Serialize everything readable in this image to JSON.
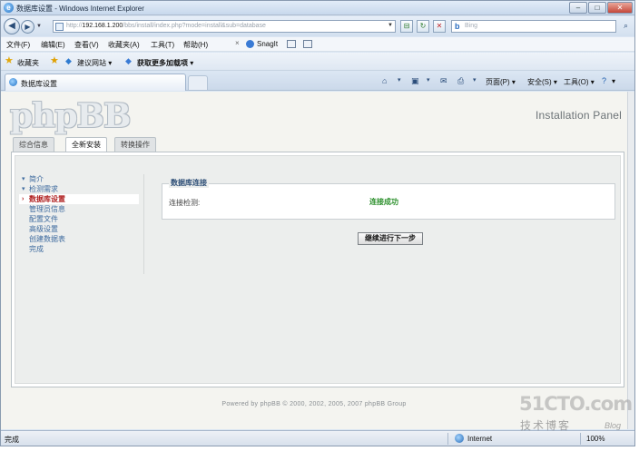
{
  "window": {
    "title": "数据库设置 - Windows Internet Explorer",
    "minimize": "–",
    "maximize": "□",
    "close": "✕"
  },
  "nav": {
    "url_prefix": "http://",
    "url_host": "192.168.1.200",
    "url_path": "/bbs/install/index.php?mode=install&sub=database",
    "search_placeholder": "Bing",
    "search_provider": "b"
  },
  "menu": {
    "items": [
      "文件(F)",
      "编辑(E)",
      "查看(V)",
      "收藏夹(A)",
      "工具(T)",
      "帮助(H)"
    ],
    "snagit": "SnagIt",
    "snagit_close": "×"
  },
  "favbar": {
    "favorites": "收藏夹",
    "suggested": "建议网站 ▾",
    "addons": "获取更多加载项 ▾"
  },
  "tabs": {
    "current_tab": "数据库设置",
    "commands": {
      "page": "页面(P) ▾",
      "safety": "安全(S) ▾",
      "tools": "工具(O) ▾",
      "help": "▾"
    }
  },
  "page": {
    "logo": "phpBB",
    "panel_title": "Installation Panel",
    "tabs": [
      "综合信息",
      "全新安装",
      "转换操作"
    ],
    "active_tab": 1,
    "sidebar": [
      {
        "label": "简介",
        "arrow": "▾"
      },
      {
        "label": "检测需求",
        "arrow": "▾"
      },
      {
        "label": "数据库设置",
        "arrow": "›"
      },
      {
        "label": "管理员信息",
        "arrow": ""
      },
      {
        "label": "配置文件",
        "arrow": ""
      },
      {
        "label": "高级设置",
        "arrow": ""
      },
      {
        "label": "创建数据表",
        "arrow": ""
      },
      {
        "label": "完成",
        "arrow": ""
      }
    ],
    "current_step": 2,
    "fieldset": {
      "legend": "数据库连接",
      "label": "连接检测:",
      "value": "连接成功"
    },
    "next_button": "继续进行下一步",
    "footer": "Powered by phpBB © 2000, 2002, 2005, 2007 phpBB Group"
  },
  "status": {
    "text": "完成",
    "zone": "Internet",
    "zoom": "100%"
  },
  "watermark": {
    "line1": "51CTO.com",
    "line2": "技术博客",
    "line3": "Blog"
  },
  "colors": {
    "sidebar_link": "#3d6a9e",
    "current_step": "#b02020",
    "success": "#2b8f2b"
  }
}
